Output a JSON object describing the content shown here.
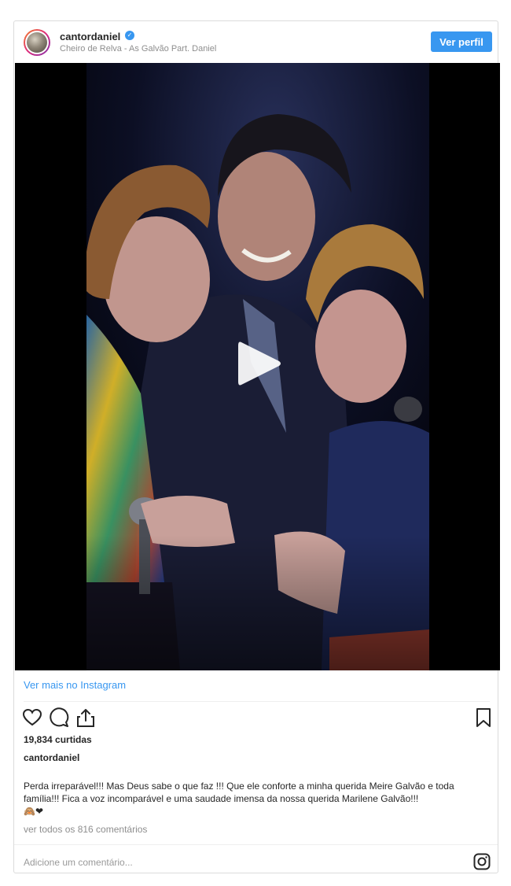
{
  "header": {
    "username": "cantordaniel",
    "verified_badge": "✓",
    "subtitle": "Cheiro de Relva - As Galvão Part. Daniel",
    "profile_button": "Ver perfil"
  },
  "media": {
    "type": "video",
    "play_icon": "play-icon"
  },
  "footer": {
    "more_link": "Ver mais no Instagram",
    "icons": [
      "heart-icon",
      "comment-icon",
      "share-icon",
      "bookmark-icon"
    ],
    "likes": "19,834 curtidas",
    "owner": "cantordaniel",
    "caption": "Perda irreparável!!! Mas Deus sabe o que faz !!! Que ele conforte a minha querida Meire Galvão e toda família!!! Fica a voz incomparável e uma saudade imensa da nossa querida Marilene Galvão!!!",
    "emojis": "🙈❤",
    "view_comments": "ver todos os 816 comentários",
    "comment_placeholder": "Adicione um comentário...",
    "instagram_icon": "instagram-icon"
  },
  "colors": {
    "accent": "#3897f0",
    "text": "#262626",
    "muted": "#8e8e8e",
    "border": "#dbdbdb"
  }
}
